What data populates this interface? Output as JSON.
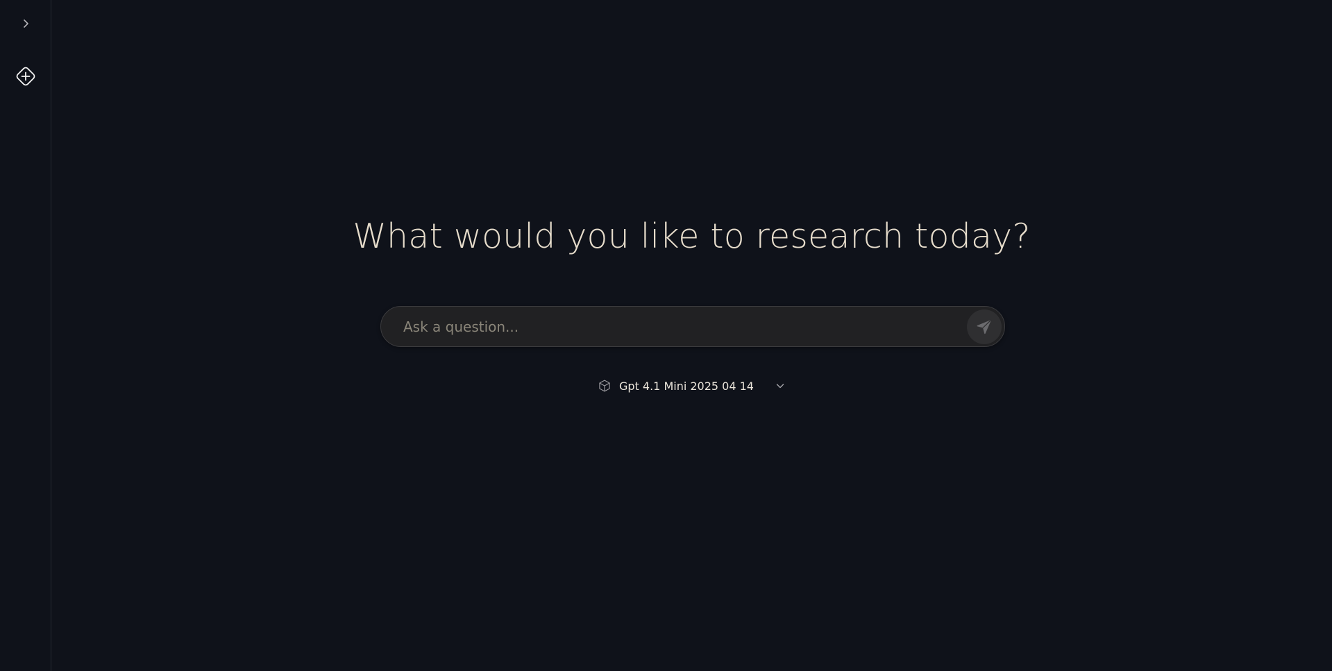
{
  "sidebar": {
    "toggle_icon": "chevron-right-icon",
    "new_chat_icon": "plus-diamond-icon"
  },
  "main": {
    "headline": "What would you like to research today?",
    "search": {
      "value": "",
      "placeholder": "Ask a question...",
      "send_icon": "send-icon"
    },
    "model": {
      "icon": "cube-icon",
      "selected": "Gpt 4.1 Mini 2025 04 14",
      "dropdown_icon": "chevron-down-icon"
    }
  },
  "colors": {
    "background": "#0f121a",
    "headline": "#e6dccb",
    "input_bg": "#212123",
    "input_border": "#3b3b3e",
    "send_button_bg": "#2f2f31"
  }
}
